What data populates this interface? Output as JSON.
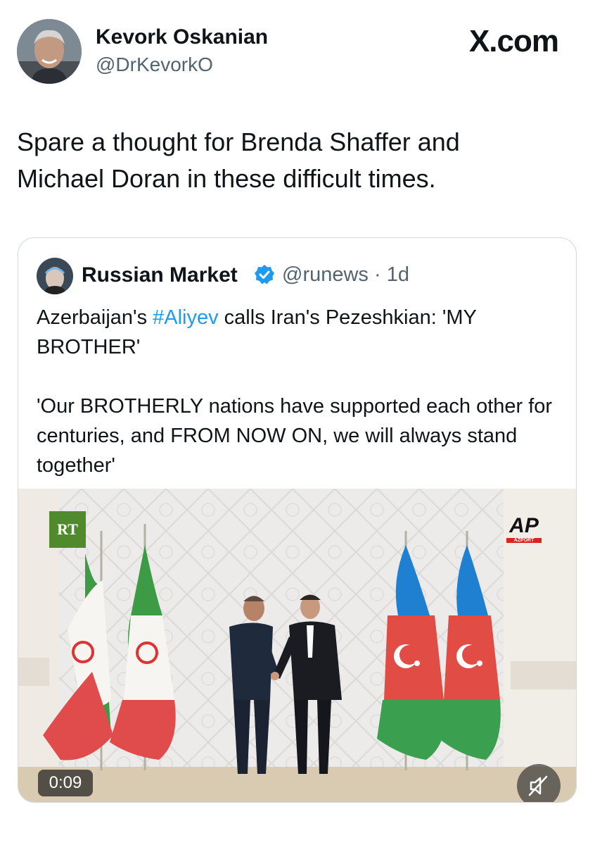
{
  "author": {
    "name": "Kevork Oskanian",
    "handle": "@DrKevorkO"
  },
  "brand": "X.com",
  "tweet": {
    "line1": "Spare a thought for Brenda Shaffer and",
    "line2": "Michael Doran in these difficult times."
  },
  "quoted": {
    "name": "Russian Market",
    "handle_time": "@runews · 1d",
    "text_before_tag": "Azerbaijan's ",
    "hashtag": "#Aliyev",
    "text_after_tag": " calls Iran's Pezeshkian: 'MY BROTHER'",
    "quote": "'Our BROTHERLY nations have supported each other for centuries, and FROM NOW ON, we will always stand together'"
  },
  "video": {
    "duration": "0:09",
    "watermark_left": "RT",
    "watermark_right": "AP",
    "watermark_right_sub": "AZPORT"
  },
  "colors": {
    "link": "#1d9bf0",
    "verified": "#1d9bf0",
    "text": "#0f1419",
    "secondary": "#536471"
  },
  "icons": {
    "verified": "verified-badge-icon",
    "mute": "muted-speaker-icon"
  }
}
